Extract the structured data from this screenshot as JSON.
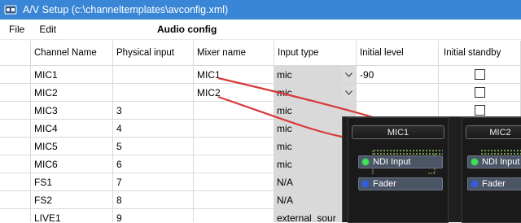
{
  "window": {
    "title": "A/V Setup (c:\\channeltemplates\\avconfig.xml)",
    "icon": "av-setup-icon"
  },
  "menu": {
    "file": "File",
    "edit": "Edit",
    "section_title": "Audio config"
  },
  "table": {
    "headers": [
      "Channel Name",
      "Physical input",
      "Mixer name",
      "Input type",
      "Initial level",
      "Initial standby"
    ],
    "rows": [
      {
        "channel": "MIC1",
        "physical": "",
        "mixer": "MIC1",
        "input_type": "mic",
        "level": "-90",
        "standby": false
      },
      {
        "channel": "MIC2",
        "physical": "",
        "mixer": "MIC2",
        "input_type": "mic",
        "level": "",
        "standby": false
      },
      {
        "channel": "MIC3",
        "physical": "3",
        "mixer": "",
        "input_type": "mic",
        "level": "",
        "standby": false
      },
      {
        "channel": "MIC4",
        "physical": "4",
        "mixer": "",
        "input_type": "mic",
        "level": "",
        "standby": false
      },
      {
        "channel": "MIC5",
        "physical": "5",
        "mixer": "",
        "input_type": "mic",
        "level": "",
        "standby": false
      },
      {
        "channel": "MIC6",
        "physical": "6",
        "mixer": "",
        "input_type": "mic",
        "level": "",
        "standby": false
      },
      {
        "channel": "FS1",
        "physical": "7",
        "mixer": "",
        "input_type": "N/A",
        "level": "",
        "standby": false
      },
      {
        "channel": "FS2",
        "physical": "8",
        "mixer": "",
        "input_type": "N/A",
        "level": "",
        "standby": false
      },
      {
        "channel": "LIVE1",
        "physical": "9",
        "mixer": "",
        "input_type": "external_sour",
        "level": "",
        "standby": false
      }
    ]
  },
  "mixer": {
    "strips": [
      {
        "name": "MIC1",
        "ndi_label": "NDI Input",
        "fader_label": "Fader"
      },
      {
        "name": "MIC2",
        "ndi_label": "NDI Input",
        "fader_label": "Fader"
      }
    ]
  },
  "colors": {
    "titlebar": "#3a86d6",
    "wire": "#d83a3a",
    "input_type_bg": "#d9d9d9",
    "mixer_bg": "#1f1f1f",
    "led_green": "#3fe05a",
    "led_blue": "#2f5fe0"
  }
}
